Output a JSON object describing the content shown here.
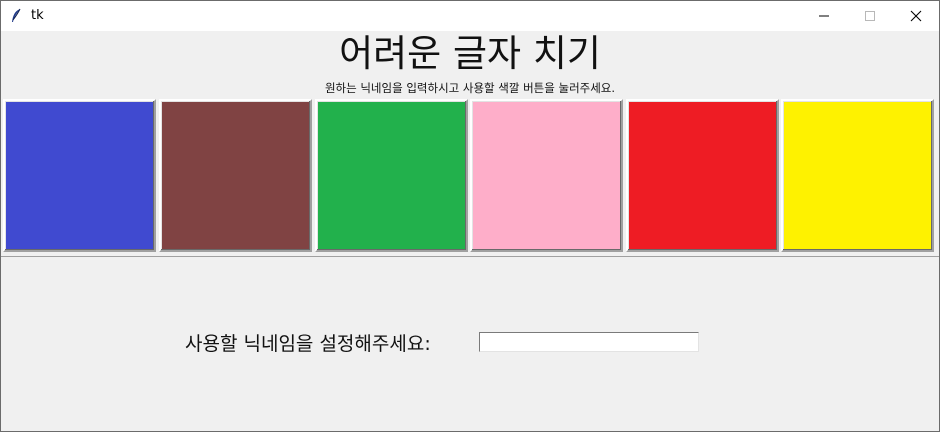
{
  "window": {
    "title": "tk"
  },
  "main": {
    "title": "어려운 글자 치기",
    "subtitle": "원하는 닉네임을 입력하시고 사용할 색깔 버튼을 눌러주세요.",
    "color_buttons": [
      {
        "name": "blue",
        "color": "#404ad0"
      },
      {
        "name": "brown",
        "color": "#804343"
      },
      {
        "name": "green",
        "color": "#22b14c"
      },
      {
        "name": "pink",
        "color": "#feaec9"
      },
      {
        "name": "red",
        "color": "#ee1c24"
      },
      {
        "name": "yellow",
        "color": "#fef200"
      }
    ],
    "nickname_prompt": "사용할 닉네임을 설정해주세요:",
    "nickname_value": ""
  }
}
